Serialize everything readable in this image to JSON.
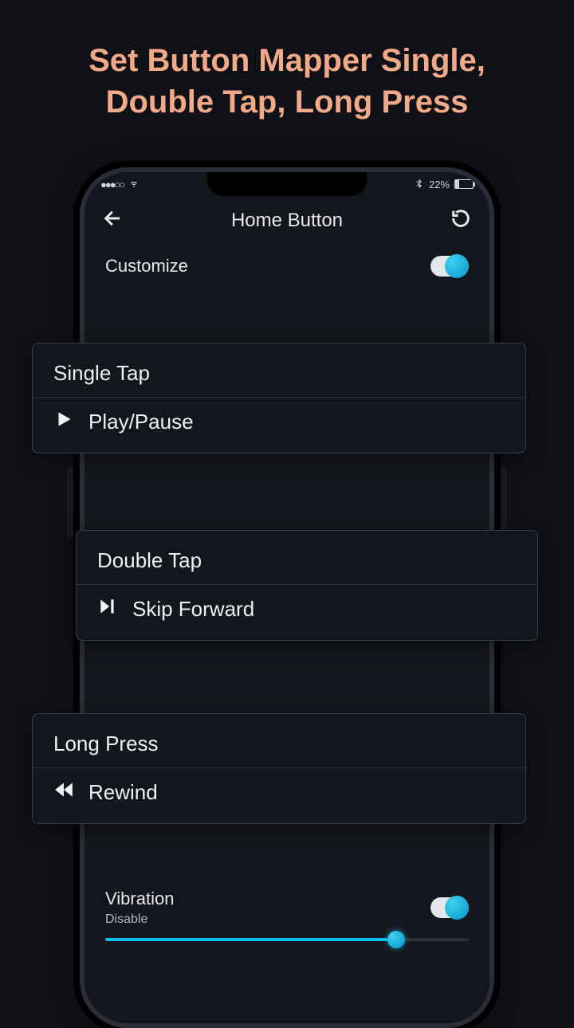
{
  "headline": "Set Button Mapper Single, Double Tap, Long Press",
  "status": {
    "battery": "22%"
  },
  "header": {
    "title": "Home Button"
  },
  "customize": {
    "label": "Customize"
  },
  "cards": {
    "single": {
      "title": "Single Tap",
      "action": "Play/Pause"
    },
    "double": {
      "title": "Double Tap",
      "action": "Skip Forward"
    },
    "long": {
      "title": "Long Press",
      "action": "Rewind"
    }
  },
  "vibration": {
    "label": "Vibration",
    "sub": "Disable"
  }
}
